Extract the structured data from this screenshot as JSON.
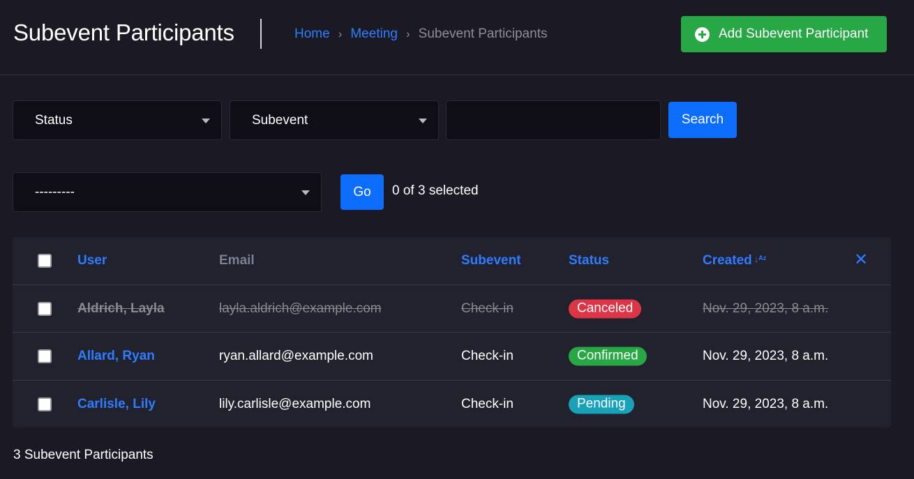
{
  "header": {
    "title": "Subevent Participants",
    "breadcrumb": {
      "home": "Home",
      "meeting": "Meeting",
      "separator": "›",
      "current": "Subevent Participants"
    },
    "add_button_label": "Add Subevent Participant"
  },
  "filters": {
    "status_label": "Status",
    "subevent_label": "Subevent",
    "search_value": "",
    "search_button": "Search"
  },
  "actions": {
    "action_select_value": "---------",
    "go_button": "Go",
    "selected_count": "0 of 3 selected"
  },
  "table": {
    "headers": {
      "user": "User",
      "email": "Email",
      "subevent": "Subevent",
      "status": "Status",
      "created": "Created",
      "sort_glyph": "↓ᴬᶻ",
      "clear_glyph": "✕"
    },
    "rows": [
      {
        "user": "Aldrich, Layla",
        "email": "layla.aldrich@example.com",
        "subevent": "Check-in",
        "status": "Canceled",
        "created": "Nov. 29, 2023, 8 a.m."
      },
      {
        "user": "Allard, Ryan",
        "email": "ryan.allard@example.com",
        "subevent": "Check-in",
        "status": "Confirmed",
        "created": "Nov. 29, 2023, 8 a.m."
      },
      {
        "user": "Carlisle, Lily",
        "email": "lily.carlisle@example.com",
        "subevent": "Check-in",
        "status": "Pending",
        "created": "Nov. 29, 2023, 8 a.m."
      }
    ]
  },
  "footer": {
    "count_text": "3 Subevent Participants"
  },
  "colors": {
    "background": "#1b1a24",
    "link": "#2f7dff",
    "success": "#28a745",
    "primary": "#0d6efd",
    "canceled": "#dc3545",
    "confirmed": "#28a745",
    "pending": "#17a2b8"
  }
}
